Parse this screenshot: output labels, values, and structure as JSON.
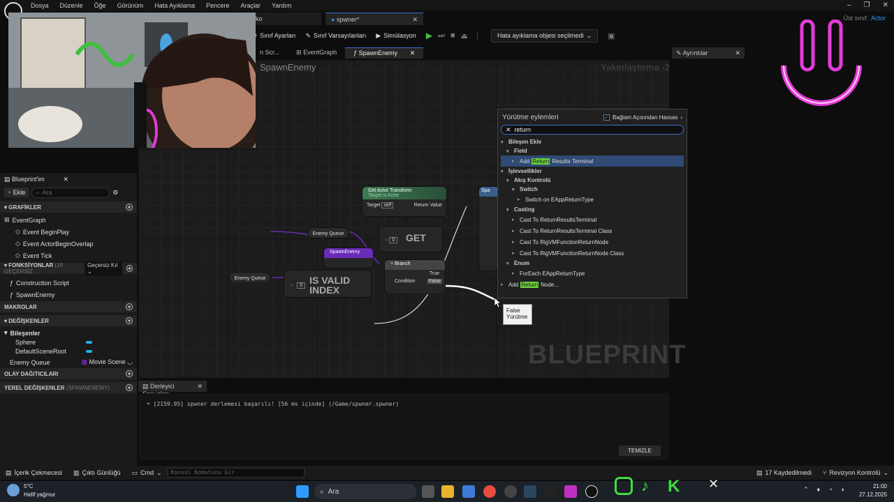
{
  "menu": [
    "Dosya",
    "Düzenle",
    "Öğe",
    "Görünüm",
    "Hata Ayıklama",
    "Pencere",
    "Araçlar",
    "Yardım"
  ],
  "parent_class": {
    "label": "Üst sınıf:",
    "value": "Actor"
  },
  "asset_tabs": {
    "left_fragment": "ko",
    "active": "spwner*"
  },
  "toolbar": {
    "class_settings": "Sınıf Ayarları",
    "class_defaults": "Sınıf Varsayılanları",
    "simulation": "Simülasyon",
    "debug_object": "Hata ayıklama objesi seçilmedi"
  },
  "graph_tabs": [
    "n Scr...",
    "EventGraph",
    "SpawnEnemy"
  ],
  "graph": {
    "title": "SpawnEnemy",
    "zoom": "Yakınlaştırma -2",
    "watermark": "BLUEPRINT"
  },
  "details_tab": "Ayrıntılar",
  "nodes": {
    "get_actor_transform": {
      "title": "Get Actor Transform",
      "sub": "Target is Actor",
      "target": "Target",
      "self": "self",
      "return": "Return Value"
    },
    "enemy_queue_1": "Enemy Queue",
    "enemy_queue_2": "Enemy Queue",
    "get": "GET",
    "get_index": "0",
    "spawn_enemy": "SpawnEnemy",
    "branch": {
      "title": "Branch",
      "true": "True",
      "condition": "Condition",
      "false": "False"
    },
    "is_valid": "IS VALID",
    "is_valid_2": "INDEX",
    "is_valid_index": "0",
    "right_node": "Spa"
  },
  "context_menu": {
    "title": "Yürütme eylemleri",
    "context_sensitive": "Bağlam Açısından Hassas",
    "search_value": "return",
    "items": [
      {
        "kind": "cat",
        "level": 0,
        "text": "Bileşen Ekle"
      },
      {
        "kind": "cat",
        "level": 1,
        "text": "Field"
      },
      {
        "kind": "hl",
        "level": 2,
        "pre": "Add ",
        "hl": "Return",
        "post": "Results Terminal",
        "selected": true
      },
      {
        "kind": "cat",
        "level": 0,
        "text": "İşlevsellikler"
      },
      {
        "kind": "cat",
        "level": 1,
        "text": "Akış Kontrolü"
      },
      {
        "kind": "cat",
        "level": 2,
        "text": "Switch"
      },
      {
        "kind": "plain",
        "level": 3,
        "text": "Switch on EAppReturnType"
      },
      {
        "kind": "cat",
        "level": 1,
        "text": "Casting"
      },
      {
        "kind": "plain",
        "level": 2,
        "text": "Cast To ReturnResultsTerminal"
      },
      {
        "kind": "plain",
        "level": 2,
        "text": "Cast To ReturnResultsTerminal Class"
      },
      {
        "kind": "plain",
        "level": 2,
        "text": "Cast To RigVMFunctionReturnNode"
      },
      {
        "kind": "plain",
        "level": 2,
        "text": "Cast To RigVMFunctionReturnNode Class"
      },
      {
        "kind": "cat",
        "level": 1,
        "text": "Enum"
      },
      {
        "kind": "plain",
        "level": 2,
        "text": "ForEach EAppReturnType"
      },
      {
        "kind": "hl",
        "level": 0,
        "pre": "Add ",
        "hl": "Return",
        "post": " Node..."
      }
    ]
  },
  "tooltip": [
    "False",
    "Yürütme"
  ],
  "left_panel": {
    "title": "Blueprint'im",
    "add": "Ekle",
    "search_placeholder": "Ara",
    "graphs_header": "GRAFİKLER",
    "event_graph": "EventGraph",
    "events": [
      "Event BeginPlay",
      "Event ActorBeginOverlap",
      "Event Tick"
    ],
    "functions_header": "FONKSİYONLAR",
    "functions_count": "(19 GEÇERSİZ",
    "functions_filter": "Geçersiz Kıl",
    "functions": [
      "Construction Script",
      "SpawnEnemy"
    ],
    "macros_header": "MAKROLAR",
    "variables_header": "DEĞİŞKENLER",
    "components_header": "Bileşenler",
    "components": [
      "Sphere",
      "DefaultSceneRoot"
    ],
    "enemy_queue": "Enemy Queue",
    "enemy_queue_type": "Movie Scene",
    "dispatchers_header": "OLAY DAĞITICILARI",
    "locals_header": "YEREL DEĞİŞKENLER",
    "locals_sub": "(SPAWNENEMY)"
  },
  "compiler": {
    "tab": "Derleyici Sonuçları",
    "line": "[2159.95] spwner derlemesi başarılı! [56 ms içinde] (/Game/spwner.spwner)",
    "clear": "TEMİZLE"
  },
  "statusbar": {
    "content_drawer": "İçerik Çekmecesi",
    "output_log": "Çıktı Günlüğü",
    "cmd": "Cmd",
    "console_placeholder": "Konsol Komutunu Gir",
    "unsaved": "17 Kaydedilmedi",
    "revision": "Revizyon Kontrolü"
  },
  "taskbar": {
    "weather_temp": "5°C",
    "weather_desc": "Hafif yağmur",
    "search": "Ara",
    "time": "21:00",
    "date": "27.12.2025"
  },
  "colors": {
    "accent": "#3a6fd0",
    "green_hl": "#6fd13d",
    "magenta": "#e53ad8",
    "function_node": "#2d6a4f",
    "purple_var": "#8a2be2"
  }
}
